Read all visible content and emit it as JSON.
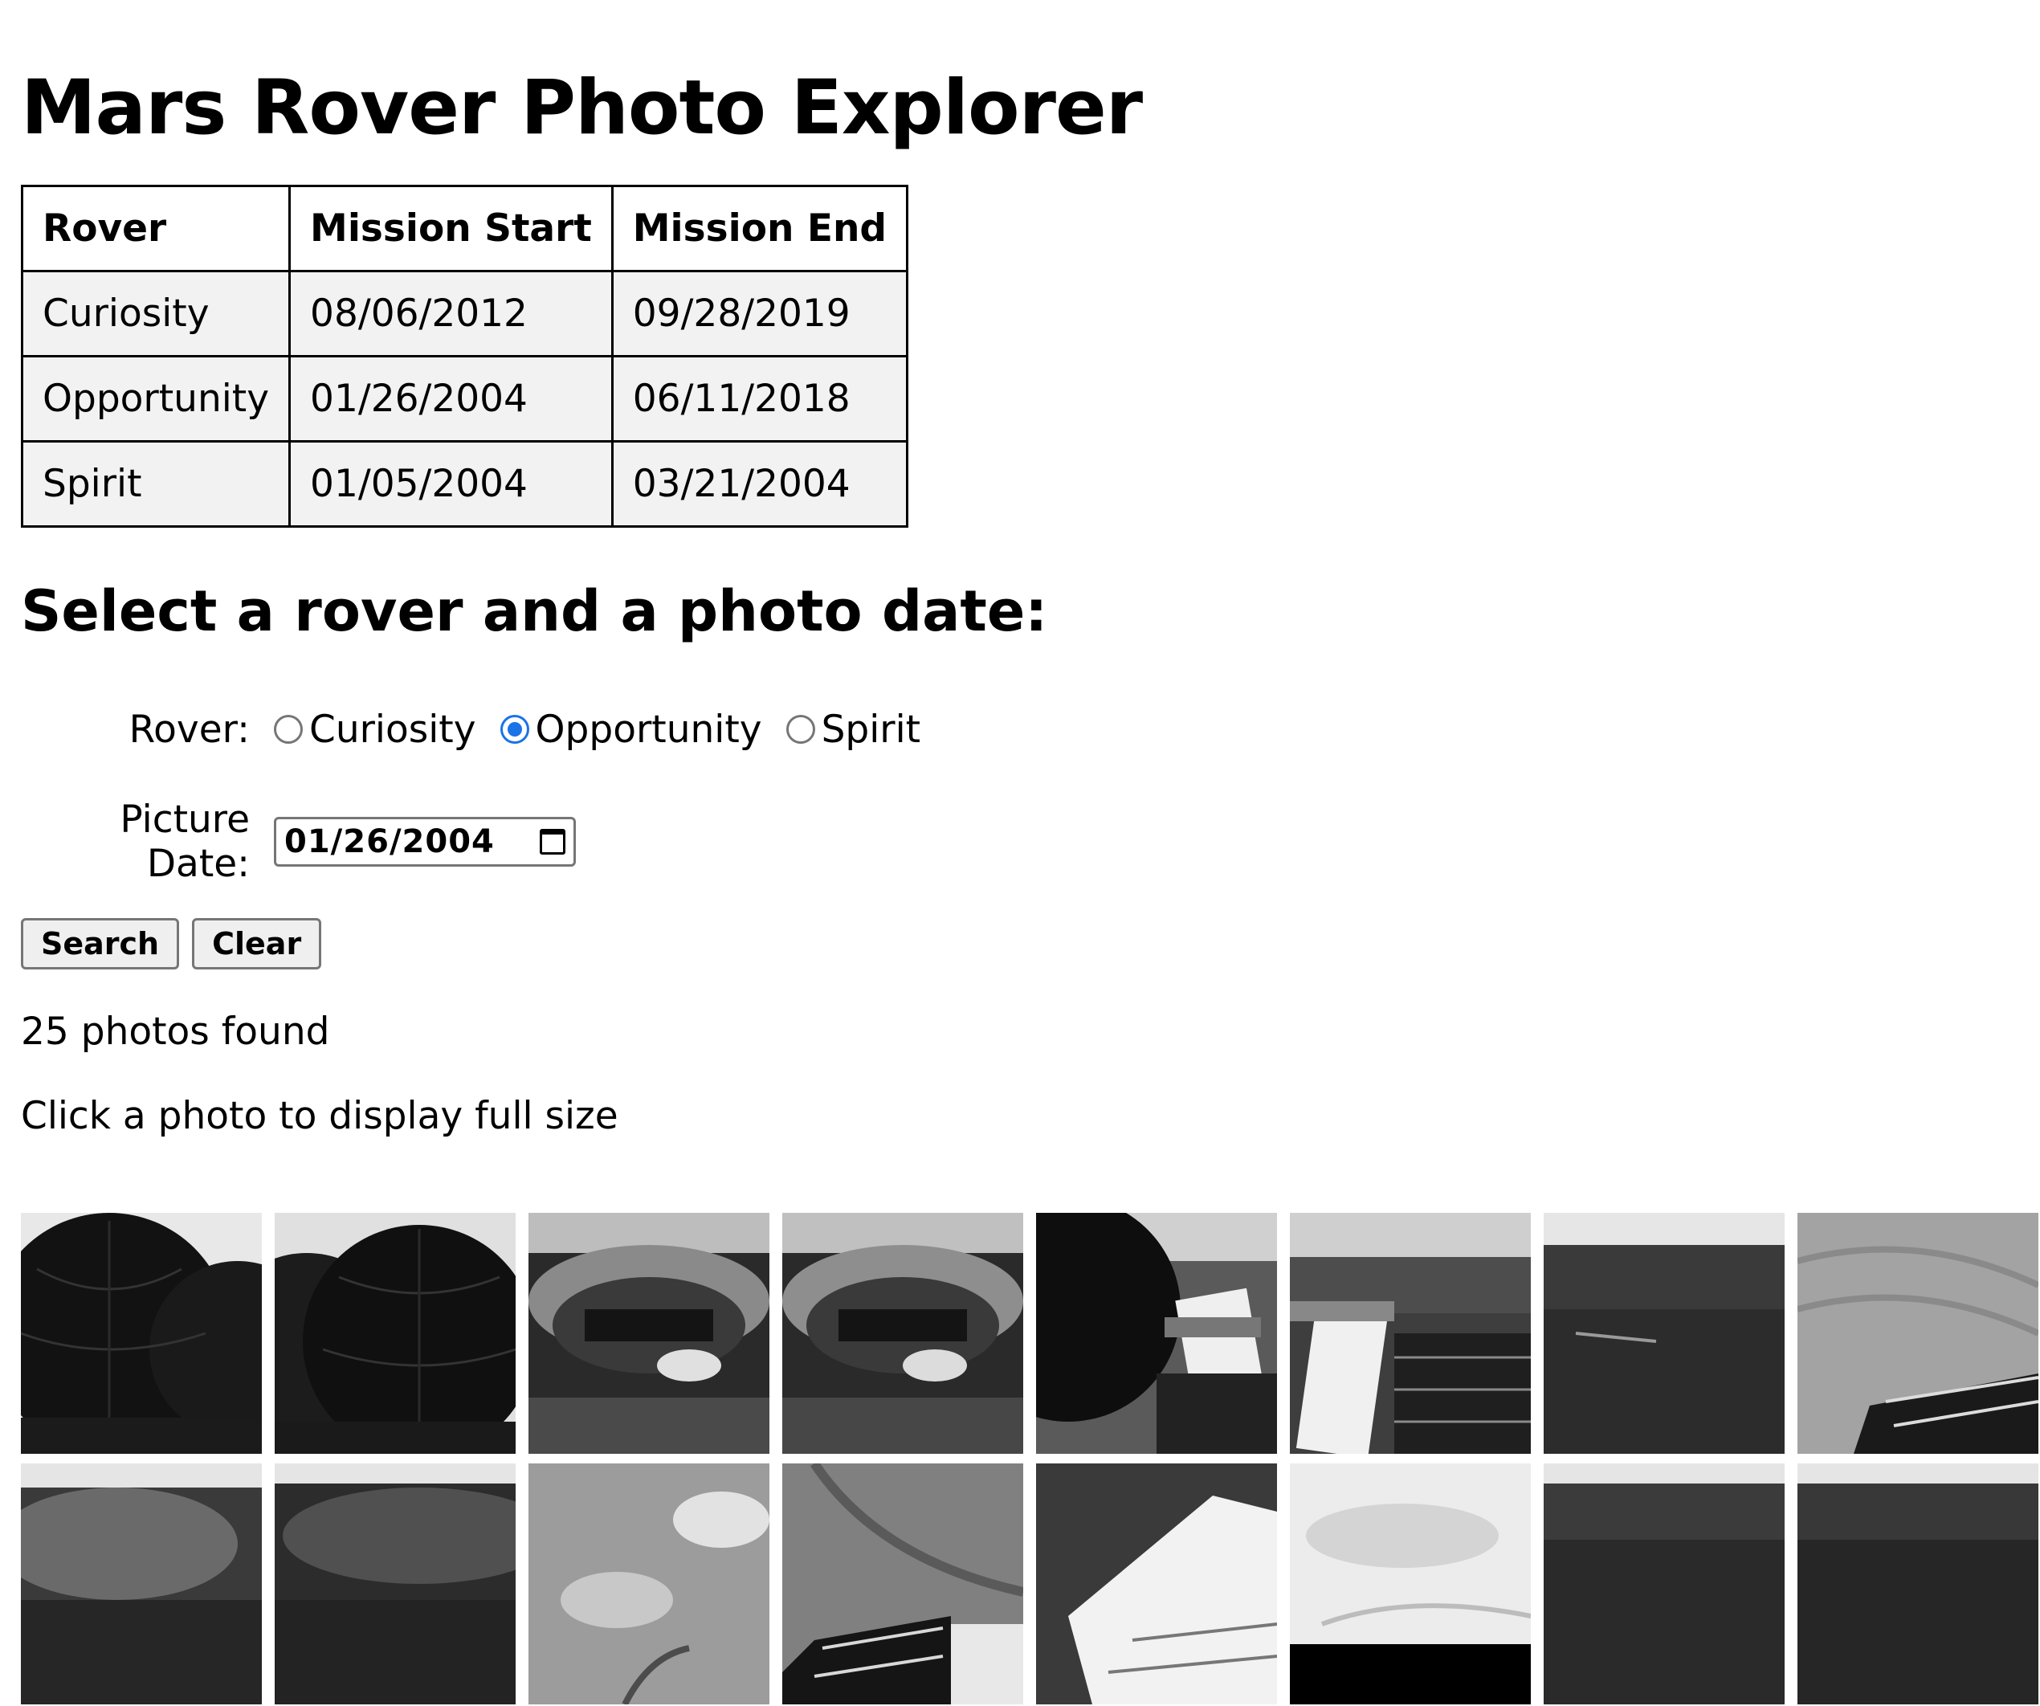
{
  "title": "Mars Rover Photo Explorer",
  "table": {
    "headers": [
      "Rover",
      "Mission Start",
      "Mission End"
    ],
    "rows": [
      [
        "Curiosity",
        "08/06/2012",
        "09/28/2019"
      ],
      [
        "Opportunity",
        "01/26/2004",
        "06/11/2018"
      ],
      [
        "Spirit",
        "01/05/2004",
        "03/21/2004"
      ]
    ]
  },
  "form": {
    "heading": "Select a rover and a photo date:",
    "rover_label": "Rover:",
    "rover_options": [
      "Curiosity",
      "Opportunity",
      "Spirit"
    ],
    "selected_rover": "Opportunity",
    "date_label": "Picture Date:",
    "date_value": "01/26/2004",
    "search_label": "Search",
    "clear_label": "Clear"
  },
  "results": {
    "count_text": "25 photos found",
    "hint_text": "Click a photo to display full size"
  },
  "colors": {
    "radio_checked": "#1a73e8",
    "table_cell_bg": "#f2f2f2",
    "button_bg": "#efefef"
  },
  "icons": {
    "date_picker": "calendar-icon"
  }
}
